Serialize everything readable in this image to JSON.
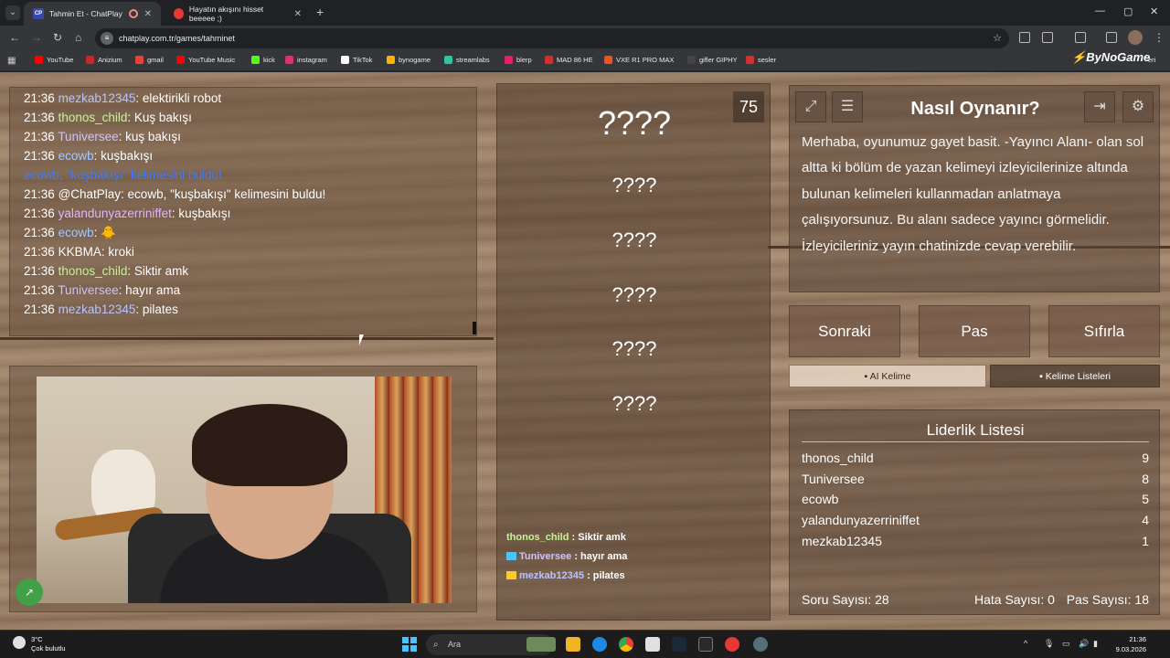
{
  "browser": {
    "tabs": [
      {
        "title": "Tahmin Et - ChatPlay",
        "favicon": "CP"
      },
      {
        "title": "Hayatın akışını hisset beeeee ;)"
      }
    ],
    "url": "chatplay.com.tr/games/tahminet",
    "bookmarks": [
      {
        "label": "YouTube",
        "color": "#ff0000"
      },
      {
        "label": "Anizium",
        "color": "#c62828"
      },
      {
        "label": "gmail",
        "color": "#ea4335"
      },
      {
        "label": "YouTube Music",
        "color": "#ff0000"
      },
      {
        "label": "kick",
        "color": "#53fc18"
      },
      {
        "label": "instagram",
        "color": "#e1306c"
      },
      {
        "label": "TikTok",
        "color": "#ffffff"
      },
      {
        "label": "bynogame",
        "color": "#ffb300"
      },
      {
        "label": "streamlabs",
        "color": "#31c3a2"
      },
      {
        "label": "blerp",
        "color": "#e91e63"
      },
      {
        "label": "MAD 86 HE",
        "color": "#d32f2f"
      },
      {
        "label": "VXE R1 PRO MAX",
        "color": "#f4511e"
      },
      {
        "label": "gifler GIPHY",
        "color": "#444444"
      },
      {
        "label": "sesler",
        "color": "#d32f2f"
      }
    ],
    "overflow_label": "eri",
    "brand_logo": "ByNoGame"
  },
  "chat": {
    "lines": [
      {
        "time": "21:36",
        "user": "mezkab12345",
        "text": ": elektirikli robot",
        "color": "#b9c3ff"
      },
      {
        "time": "21:36",
        "user": "thonos_child",
        "text": ": Kuş bakışı",
        "color": "#c6f29a"
      },
      {
        "time": "21:36",
        "user": "Tuniversee",
        "text": ": kuş bakışı",
        "color": "#cfc2ff"
      },
      {
        "time": "21:36",
        "user": "ecowb",
        "text": ": kuşbakışı",
        "color": "#a6c8ff"
      },
      {
        "time": "",
        "user": "ecowb, \"kuşbakışı\" kelimesini buldu!",
        "text": "",
        "color": "#3d7bff"
      },
      {
        "time": "21:36",
        "user": "@ChatPlay",
        "text": ": ecowb, \"kuşbakışı\" kelimesini buldu!",
        "color": "#ffffff"
      },
      {
        "time": "21:36",
        "user": "yalandunyazerriniffet",
        "text": ": kuşbakışı",
        "color": "#e3b5ff"
      },
      {
        "time": "21:36",
        "user": "ecowb",
        "text": ": ",
        "color": "#a6c8ff",
        "emoji": "🐥"
      },
      {
        "time": "21:36",
        "user": "KKBMA",
        "text": ": kroki",
        "color": "#ffffff"
      },
      {
        "time": "21:36",
        "user": "thonos_child",
        "text": ": Siktir amk",
        "color": "#c6f29a"
      },
      {
        "time": "21:36",
        "user": "Tuniversee",
        "text": ": hayır ama",
        "color": "#cfc2ff"
      },
      {
        "time": "21:36",
        "user": "mezkab12345",
        "text": ": pilates",
        "color": "#b9c3ff"
      }
    ]
  },
  "game": {
    "timer": "75",
    "words": [
      "????",
      "????",
      "????",
      "????",
      "????",
      "????"
    ],
    "mini_chat": [
      {
        "user": "thonos_child",
        "text": " : Siktir amk",
        "color": "#c6f29a"
      },
      {
        "user": "Tuniversee",
        "text": " : hayır ama",
        "color": "#cfc2ff",
        "badge": "#4fc3f7"
      },
      {
        "user": "mezkab12345",
        "text": " : pilates",
        "color": "#b9c3ff",
        "badge": "#ffca28"
      }
    ]
  },
  "how": {
    "title": "Nasıl Oynanır?",
    "text": "Merhaba, oyunumuz gayet basit. -Yayıncı Alanı- olan sol altta ki bölüm de yazan kelimeyi izleyicilerinize altında bulunan kelimeleri kullanmadan anlatmaya çalışıyorsunuz. Bu alanı sadece yayıncı görmelidir. İzleyicileriniz yayın chatinizde cevap verebilir."
  },
  "controls": {
    "next": "Sonraki",
    "pass": "Pas",
    "reset": "Sıfırla",
    "ai_word": "AI Kelime",
    "word_lists": "Kelime Listeleri"
  },
  "leaderboard": {
    "title": "Liderlik Listesi",
    "rows": [
      {
        "name": "thonos_child",
        "score": "9"
      },
      {
        "name": "Tuniversee",
        "score": "8"
      },
      {
        "name": "ecowb",
        "score": "5"
      },
      {
        "name": "yalandunyazerriniffet",
        "score": "4"
      },
      {
        "name": "mezkab12345",
        "score": "1"
      }
    ],
    "questions": "Soru Sayısı: 28",
    "errors": "Hata Sayısı: 0",
    "passes": "Pas Sayısı: 18"
  },
  "taskbar": {
    "temp": "3°C",
    "weather": "Çok bulutlu",
    "search": "Ara",
    "time": "21:36",
    "date": "9.03.2026"
  }
}
